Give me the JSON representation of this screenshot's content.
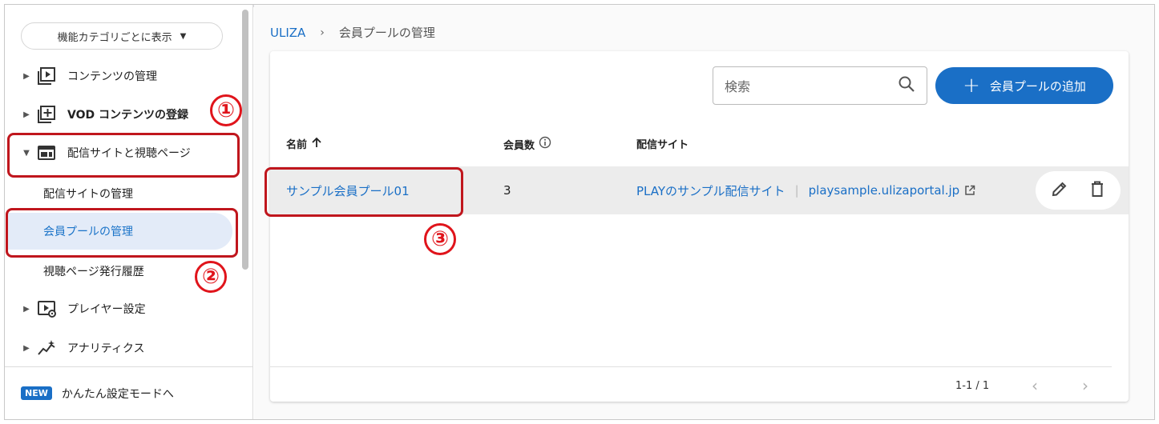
{
  "sidebar": {
    "category_button": "機能カテゴリごとに表示",
    "items": [
      {
        "label": "コンテンツの管理"
      },
      {
        "label": "VOD コンテンツの登録"
      },
      {
        "label": "配信サイトと視聴ページ"
      },
      {
        "label": "配信サイトの管理"
      },
      {
        "label": "会員プールの管理"
      },
      {
        "label": "視聴ページ発行履歴"
      },
      {
        "label": "プレイヤー設定"
      },
      {
        "label": "アナリティクス"
      }
    ],
    "footer": {
      "badge": "NEW",
      "label": "かんたん設定モードへ"
    }
  },
  "annotations": [
    "①",
    "②",
    "③"
  ],
  "breadcrumb": {
    "root": "ULIZA",
    "separator": "›",
    "current": "会員プールの管理"
  },
  "toolbar": {
    "search_placeholder": "検索",
    "add_button": "会員プールの追加"
  },
  "table": {
    "columns": [
      "名前",
      "会員数",
      "配信サイト"
    ],
    "rows": [
      {
        "name": "サンプル会員プール01",
        "members": "3",
        "site_name": "PLAYのサンプル配信サイト",
        "site_url": "playsample.ulizaportal.jp"
      }
    ]
  },
  "pagination": {
    "range": "1-1 / 1"
  },
  "colors": {
    "accent": "#1a6fc6",
    "annotation": "#e0141b",
    "active_bg": "#e3ebf8"
  }
}
